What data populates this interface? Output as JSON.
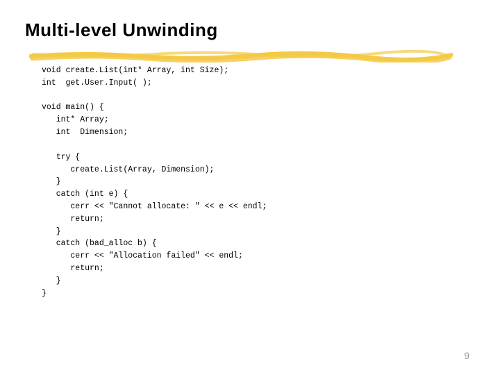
{
  "slide": {
    "title": "Multi-level Unwinding",
    "page_number": "9"
  },
  "code": {
    "line1": "void create.List(int* Array, int Size);",
    "line2": "int  get.User.Input( );",
    "blank1": "",
    "line3": "void main() {",
    "line4": "   int* Array;",
    "line5": "   int  Dimension;",
    "blank2": "",
    "line6": "   try {",
    "line7": "      create.List(Array, Dimension);",
    "line8": "   }",
    "line9": "   catch (int e) {",
    "line10": "      cerr << \"Cannot allocate: \" << e << endl;",
    "line11": "      return;",
    "line12": "   }",
    "line13": "   catch (bad_alloc b) {",
    "line14": "      cerr << \"Allocation failed\" << endl;",
    "line15": "      return;",
    "line16": "   }",
    "line17": "}"
  },
  "style": {
    "title_font_size": "26px",
    "underline_color": "#f4c945"
  }
}
